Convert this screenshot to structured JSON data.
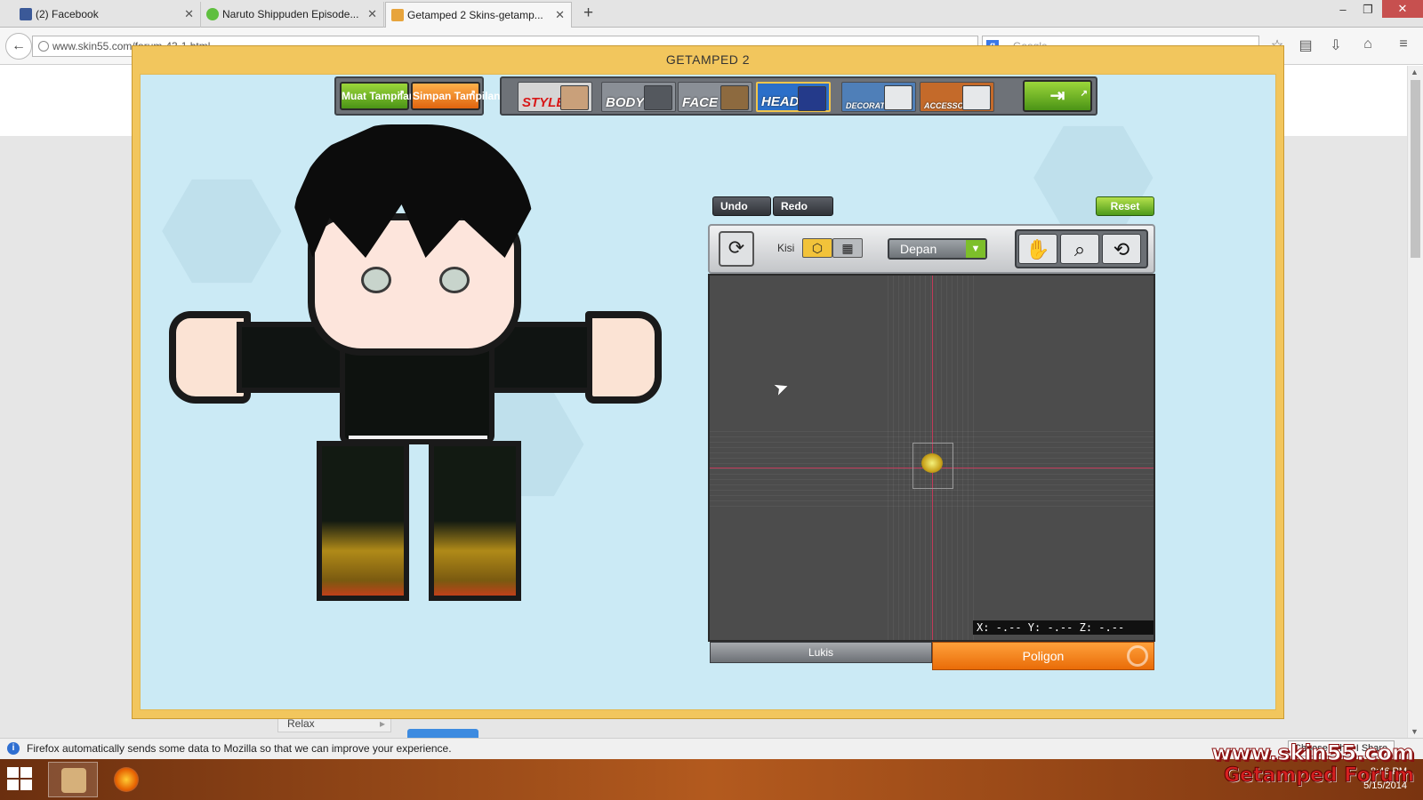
{
  "browser": {
    "tabs": [
      {
        "title": "(2) Facebook",
        "favicon_color": "#3b5998"
      },
      {
        "title": "Naruto Shippuden Episode...",
        "favicon_color": "#5fbf3f"
      },
      {
        "title": "Getamped 2 Skins-getamp...",
        "favicon_color": "#e7a43c"
      }
    ],
    "new_tab": "+",
    "url": "www.skin55.com/forum-43-1.html",
    "search_placeholder": "Google",
    "search_engine_letter": "g",
    "window_controls": {
      "minimize": "–",
      "maximize": "❐",
      "close": "✕"
    },
    "nav_icons": {
      "back": "←",
      "bookmark": "☆",
      "reading_list": "▤",
      "download": "⇩",
      "home": "⌂",
      "menu": "≡"
    }
  },
  "page": {
    "relax_label": "Relax",
    "relax_arrow": "▸"
  },
  "modal": {
    "title": "GETAMPED 2"
  },
  "game_toolbar": {
    "load_label": "Muat Tampilan",
    "save_label": "Simpan Tampilan",
    "categories": {
      "style": "STYLE",
      "body": "BODY",
      "face": "FACE",
      "head": "HEAD",
      "decoration": "DECORATION",
      "accessory": "ACCESSORY"
    },
    "exit_icon": "exit-icon"
  },
  "editor": {
    "undo_label": "Undo",
    "redo_label": "Redo",
    "reset_label": "Reset",
    "grid_label": "Kisi",
    "view_dropdown": {
      "selected": "Depan",
      "arrow": "▼"
    },
    "icons": {
      "rotate": "⟳",
      "hex_grid": "⬡",
      "square_grid": "▦",
      "hand": "✋",
      "zoom": "⌕",
      "camera": "⟲"
    },
    "coords_readout": "X: -.-- Y: -.-- Z: -.--",
    "tabs": {
      "lukis": "Lukis",
      "poligon": "Poligon"
    }
  },
  "infobar": {
    "message": "Firefox automatically sends some data to Mozilla so that we can improve your experience.",
    "icon_letter": "i",
    "choose_button": "Choose What I Share"
  },
  "taskbar": {
    "time": "8:46 PM",
    "date": "5/15/2014"
  },
  "watermark": {
    "line1": "www.skin55.com",
    "line2": "Getamped Forum"
  },
  "colors": {
    "modal_frame": "#f2c65d",
    "stage_bg": "#cbeaf5",
    "accent_orange": "#e96c08",
    "accent_green": "#4b9416"
  }
}
